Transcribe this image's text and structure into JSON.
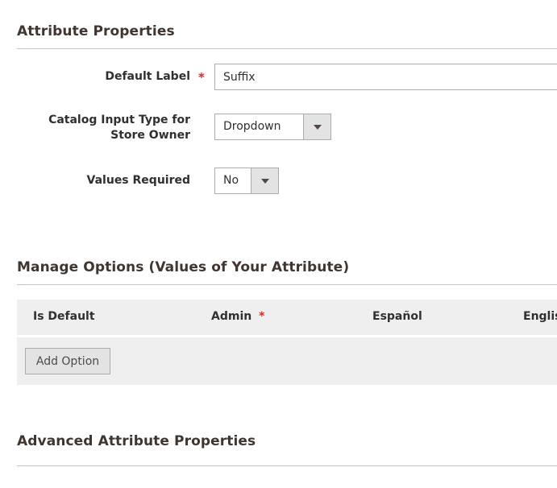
{
  "attribute_properties": {
    "title": "Attribute Properties",
    "default_label": {
      "label": "Default Label",
      "required_marker": "*",
      "value": "Suffix"
    },
    "catalog_input_type": {
      "label_line1": "Catalog Input Type for",
      "label_line2": "Store Owner",
      "selected": "Dropdown"
    },
    "values_required": {
      "label": "Values Required",
      "selected": "No"
    }
  },
  "manage_options": {
    "title": "Manage Options (Values of Your Attribute)",
    "columns": {
      "is_default": "Is Default",
      "admin": "Admin",
      "admin_required_marker": "*",
      "espanol": "Español",
      "english": "English"
    },
    "add_option_label": "Add Option"
  },
  "advanced": {
    "title": "Advanced Attribute Properties"
  },
  "colors": {
    "required": "#e22626",
    "table_bg": "#efefef",
    "button_bg": "#e3e3e3",
    "border": "#adadad"
  },
  "icons": {
    "select_arrow": "caret-down-icon"
  }
}
